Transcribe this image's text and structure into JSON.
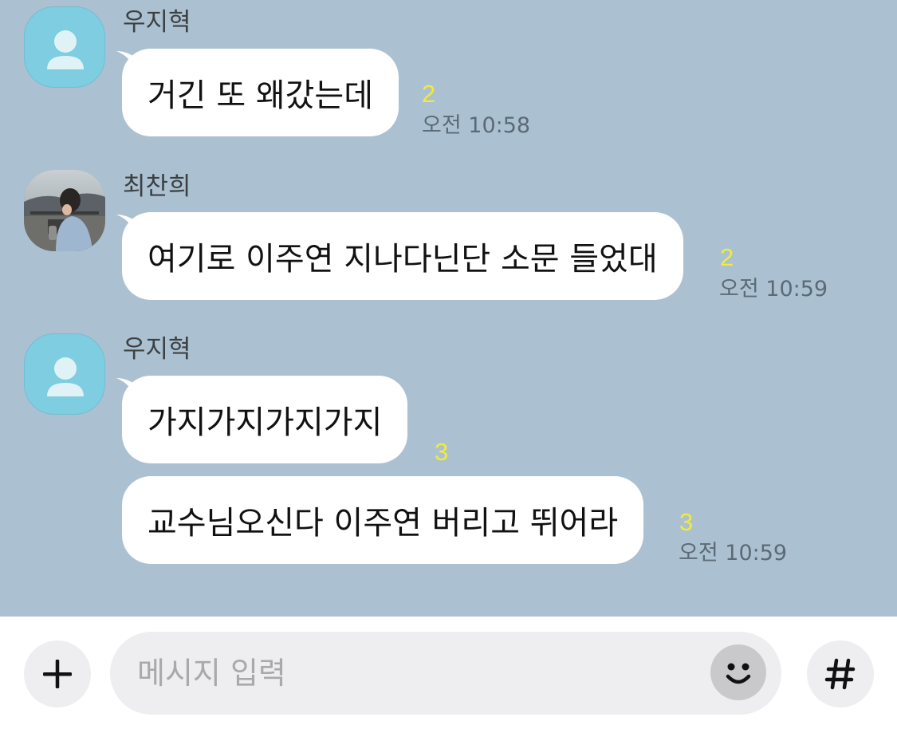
{
  "messages": [
    {
      "sender": "우지혁",
      "avatar": "default-person-icon",
      "bubbles": [
        {
          "text": "거긴 또 왜갔는데",
          "unread": "2",
          "time": "오전 10:58"
        }
      ]
    },
    {
      "sender": "최찬희",
      "avatar": "profile-photo",
      "bubbles": [
        {
          "text": "여기로 이주연 지나다닌단 소문 들었대",
          "unread": "2",
          "time": "오전 10:59"
        }
      ]
    },
    {
      "sender": "우지혁",
      "avatar": "default-person-icon",
      "bubbles": [
        {
          "text": "가지가지가지가지",
          "unread": "3",
          "time": ""
        },
        {
          "text": "교수님오신다 이주연 버리고 뛰어라",
          "unread": "3",
          "time": "오전 10:59"
        }
      ]
    }
  ],
  "input_bar": {
    "placeholder": "메시지 입력",
    "plus_icon": "plus-icon",
    "emoji_icon": "smiley-icon",
    "hash_icon": "hash-icon"
  },
  "colors": {
    "chat_background": "#abc1d1",
    "bubble": "#ffffff",
    "unread_count": "#f3ea3a",
    "default_avatar": "#7fcde0"
  }
}
